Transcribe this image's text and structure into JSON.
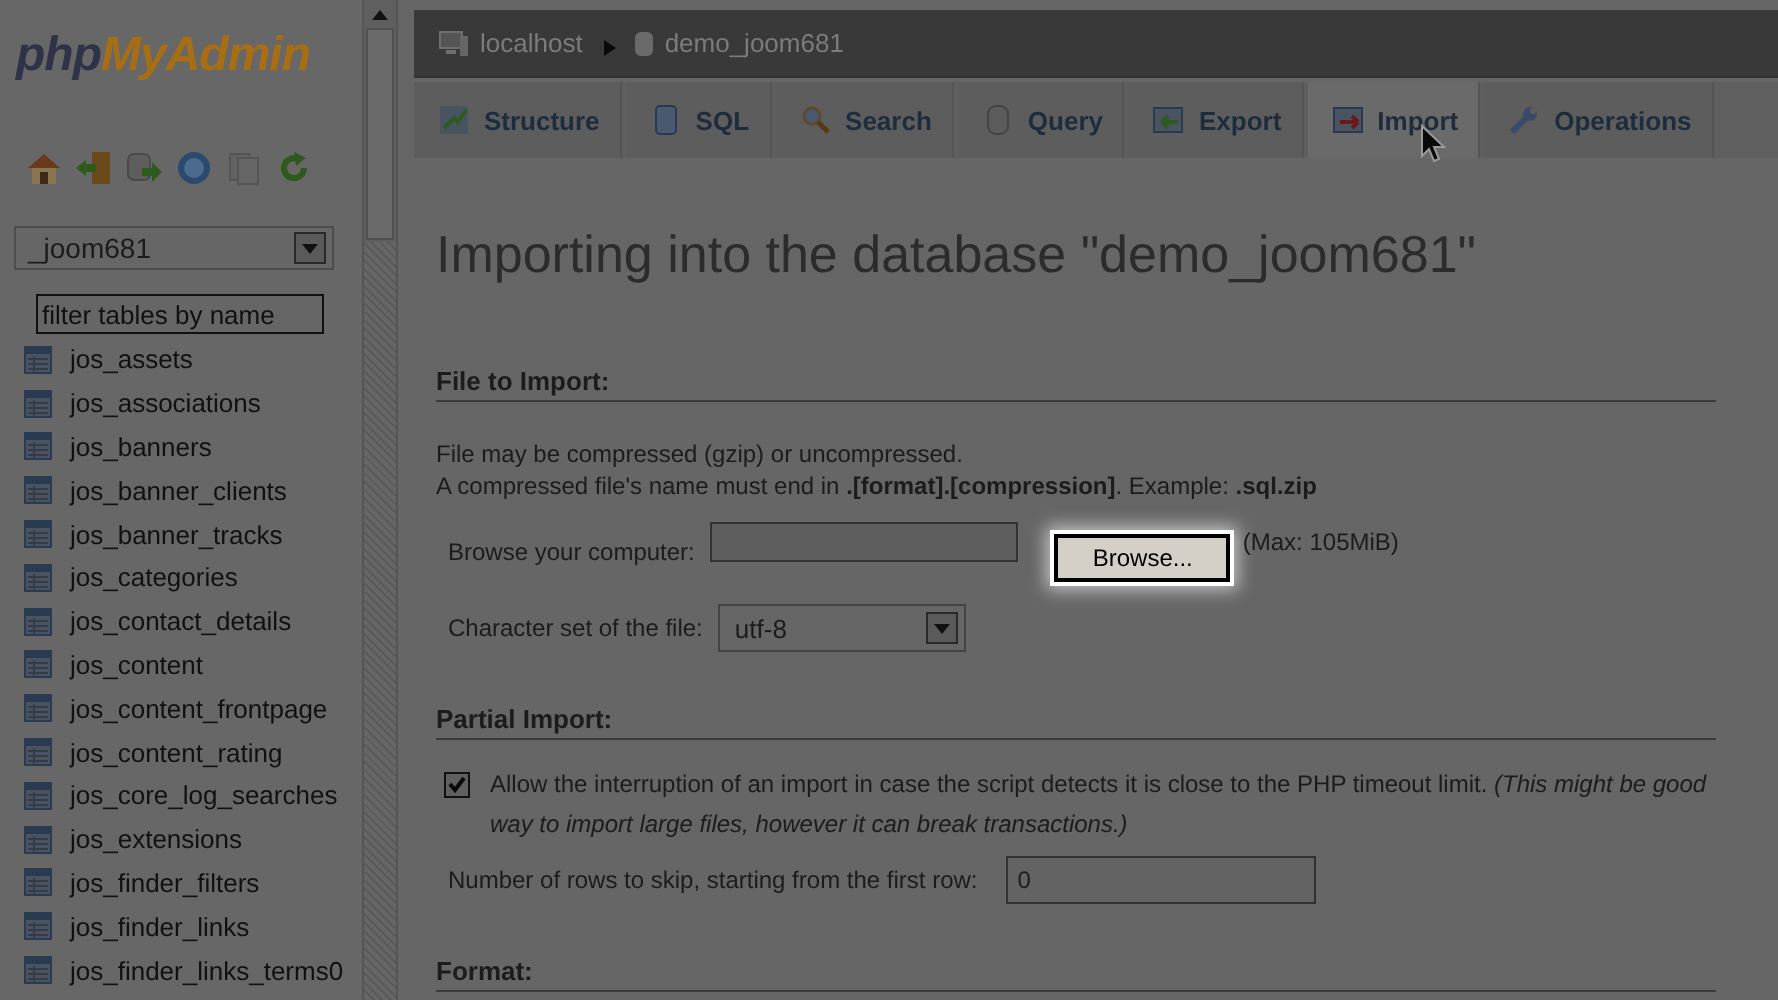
{
  "logo": {
    "first": "php",
    "second": "MyAdmin"
  },
  "database_select": {
    "value": "_joom681"
  },
  "filter": {
    "placeholder": "filter tables by name"
  },
  "tables": [
    "jos_assets",
    "jos_associations",
    "jos_banners",
    "jos_banner_clients",
    "jos_banner_tracks",
    "jos_categories",
    "jos_contact_details",
    "jos_content",
    "jos_content_frontpage",
    "jos_content_rating",
    "jos_core_log_searches",
    "jos_extensions",
    "jos_finder_filters",
    "jos_finder_links",
    "jos_finder_links_terms0"
  ],
  "breadcrumb": [
    {
      "label": "localhost",
      "kind": "server"
    },
    {
      "label": "demo_joom681",
      "kind": "database"
    }
  ],
  "tabs": [
    {
      "label": "Structure",
      "kind": "structure",
      "selected": false
    },
    {
      "label": "SQL",
      "kind": "sql",
      "selected": false
    },
    {
      "label": "Search",
      "kind": "search",
      "selected": false
    },
    {
      "label": "Query",
      "kind": "query",
      "selected": false
    },
    {
      "label": "Export",
      "kind": "export",
      "selected": false
    },
    {
      "label": "Import",
      "kind": "import",
      "selected": true
    },
    {
      "label": "Operations",
      "kind": "operations",
      "selected": false
    }
  ],
  "title": "Importing into the database \"demo_joom681\"",
  "file_to_import": {
    "heading": "File to Import:",
    "notes": [
      "File may be compressed (gzip) or uncompressed.",
      "A compressed file's name must end in **.[format].[compression]**. Example: **.sql.zip**"
    ],
    "browse_label": "Browse your computer:",
    "max_text": "(Max: 105MiB)",
    "browse_button": "Browse...",
    "charset_label": "Character set of the file:",
    "charset_value": "utf-8"
  },
  "partial_import": {
    "heading": "Partial Import:",
    "allow_interrupt": {
      "label": "Allow the interruption of an import in case the script detects it is close to the PHP timeout limit. *(This might be good way to import large files, however it can break transactions.)*",
      "checked": true
    },
    "rows_skip": {
      "label": "Number of rows to skip, starting from the first row:",
      "value": "0"
    }
  },
  "format": {
    "heading": "Format:"
  }
}
